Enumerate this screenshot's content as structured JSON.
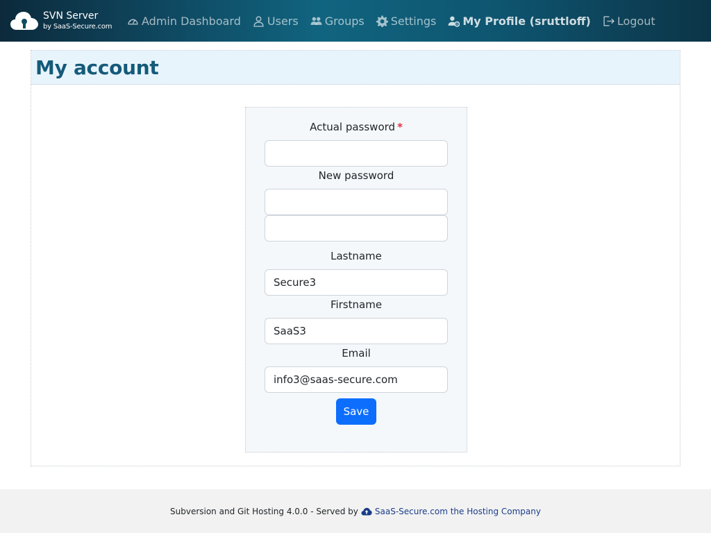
{
  "app": {
    "title": "SVN Server",
    "subtitle": "by SaaS-Secure.com"
  },
  "nav": {
    "items": [
      {
        "label": "Admin Dashboard",
        "icon": "dashboard-gauge-icon"
      },
      {
        "label": "Users",
        "icon": "user-icon"
      },
      {
        "label": "Groups",
        "icon": "users-group-icon"
      },
      {
        "label": "Settings",
        "icon": "gear-icon"
      },
      {
        "label": "My Profile (sruttloff)",
        "icon": "user-gear-icon",
        "active": true
      },
      {
        "label": "Logout",
        "icon": "logout-icon"
      }
    ]
  },
  "page": {
    "title": "My account"
  },
  "form": {
    "actual_password_label": "Actual password",
    "required_marker": "*",
    "actual_password_value": "",
    "new_password_label": "New password",
    "new_password_value": "",
    "new_password_confirm_value": "",
    "lastname_label": "Lastname",
    "lastname_value": "Secure3",
    "firstname_label": "Firstname",
    "firstname_value": "SaaS3",
    "email_label": "Email",
    "email_value": "info3@saas-secure.com",
    "save_label": "Save"
  },
  "footer": {
    "text": "Subversion and Git Hosting 4.0.0 - Served by",
    "link_text": "SaaS-Secure.com the Hosting Company",
    "link_icon": "cloud-upload-icon"
  },
  "colors": {
    "navbar_start": "#0c2a3b",
    "navbar_mid": "#11647f",
    "title": "#145a7a",
    "header_bg": "#e8f4fc",
    "primary_button": "#0d6efd",
    "required": "#dc3545",
    "footer_link": "#1a3d8a"
  }
}
